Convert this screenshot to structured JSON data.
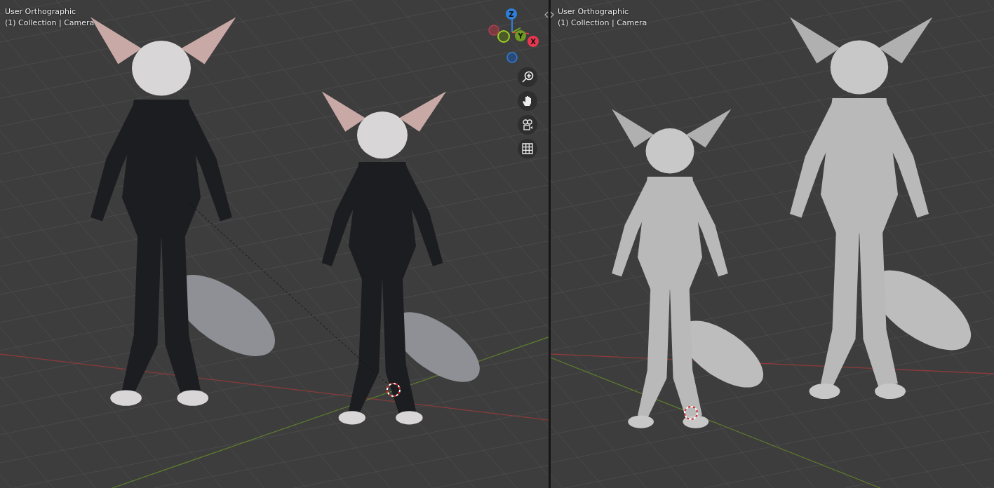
{
  "viewports": [
    {
      "kind": "material",
      "view": "User Orthographic",
      "collection": "(1) Collection | Camera",
      "gizmo": {
        "axes": [
          {
            "label": "Z",
            "color": "#2f7fd8"
          },
          {
            "label": "Y",
            "color": "#6f9a22"
          },
          {
            "label": "X",
            "color": "#e8384f"
          }
        ]
      }
    },
    {
      "kind": "solid",
      "view": "User Orthographic",
      "collection": "(1) Collection | Camera"
    }
  ]
}
